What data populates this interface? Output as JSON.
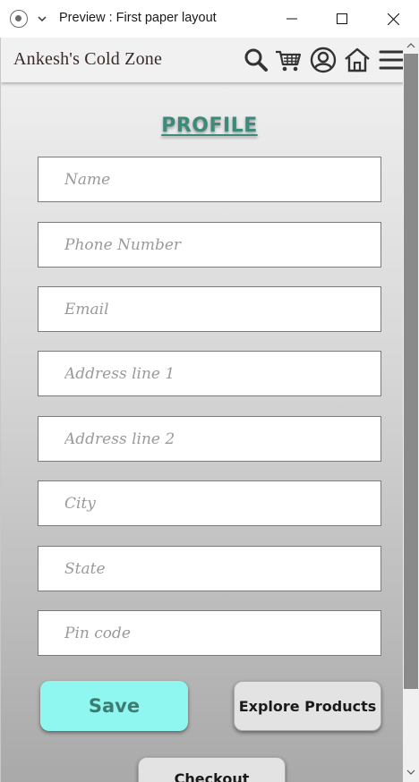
{
  "window": {
    "title": "Preview : First paper layout",
    "scroll_position": 0
  },
  "navbar": {
    "brand": "Ankesh's Cold Zone",
    "icons": [
      "search-icon",
      "cart-icon",
      "account-icon",
      "home-icon",
      "menu-icon"
    ]
  },
  "profile": {
    "title": "PROFILE",
    "fields": {
      "name": "Name",
      "phone": "Phone Number",
      "email": "Email",
      "address1": "Address line 1",
      "address2": "Address line 2",
      "city": "City",
      "state": "State",
      "pincode": "Pin code"
    }
  },
  "actions": {
    "save": "Save",
    "explore": "Explore Products",
    "checkout": "Checkout"
  },
  "colors": {
    "accent": "#3e8a7a",
    "save_bg": "#8ff7ef",
    "brand_text": "#3a2a26"
  }
}
